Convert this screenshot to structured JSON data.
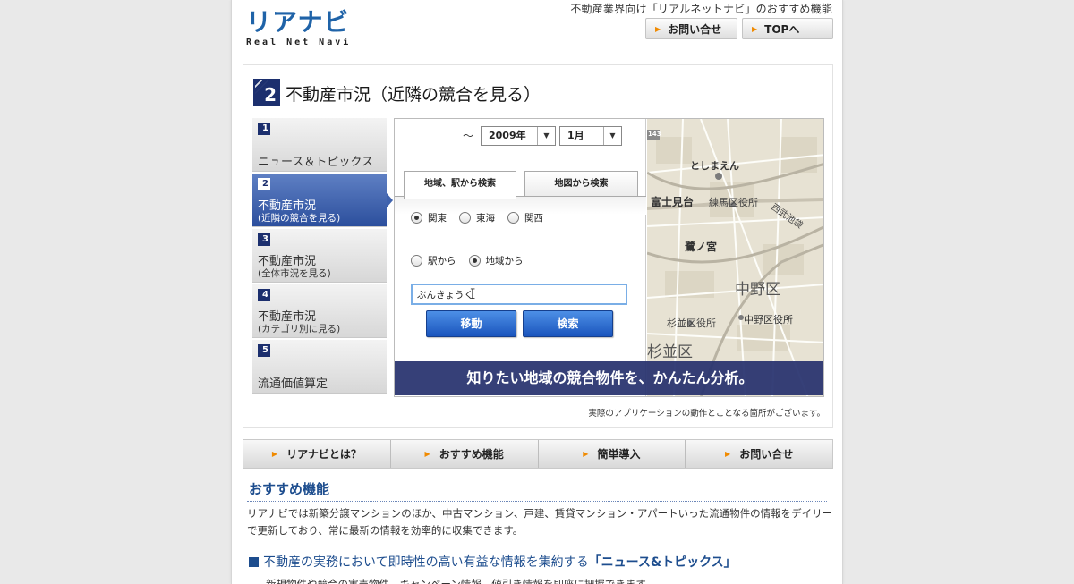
{
  "header": {
    "logo_jp": "リアナビ",
    "logo_en": "Real Net Navi",
    "tagline": "不動産業界向け「リアルネットナビ」のおすすめ機能",
    "contact_label": "お問い合せ",
    "top_label": "TOPへ"
  },
  "feature": {
    "number": "2",
    "title": "不動産市況（近隣の競合を見る）",
    "menu": [
      {
        "num": "1",
        "label": "ニュース＆トピックス",
        "sub": ""
      },
      {
        "num": "2",
        "label": "不動産市況",
        "sub": "(近隣の競合を見る)"
      },
      {
        "num": "3",
        "label": "不動産市況",
        "sub": "(全体市況を見る)"
      },
      {
        "num": "4",
        "label": "不動産市況",
        "sub": "(カテゴリ別に見る)"
      },
      {
        "num": "5",
        "label": "流通価値算定",
        "sub": ""
      }
    ],
    "screenshot": {
      "tilde": "～",
      "year": "2009年",
      "month": "1月",
      "tab_area": "地域、駅から検索",
      "tab_map": "地図から検索",
      "regions": [
        "関東",
        "東海",
        "関西"
      ],
      "modes": [
        "駅から",
        "地域から"
      ],
      "input_value": "ぶんきょうく",
      "move_label": "移動",
      "search_label": "検索",
      "banner": "知りたい地域の競合物件を、かんたん分析。",
      "map_labels": [
        "としまえん",
        "富士見台",
        "練馬区役所",
        "西武池袋",
        "鷺ノ宮",
        "中野区",
        "杉並区役所",
        "中野区役所",
        "杉並区",
        "143"
      ]
    },
    "note": "実際のアプリケーションの動作とことなる箇所がございます。"
  },
  "nav": [
    "リアナビとは？",
    "おすすめ機能",
    "簡単導入",
    "お問い合せ"
  ],
  "content": {
    "title": "おすすめ機能",
    "body": "リアナビでは新築分譲マンションのほか、中古マンション、戸建、賃貸マンション・アパートいった流通物件の情報をデイリーで更新しており、常に最新の情報を効率的に収集できます。",
    "subhead_pre": "不動産の実務において即時性の高い有益な情報を集約する",
    "subhead_quote": "「ニュース&トピックス」",
    "cut_line": "新規物件や競合の実売物件、キャンペーン情報、値引き情報を即座に把握できます。"
  }
}
